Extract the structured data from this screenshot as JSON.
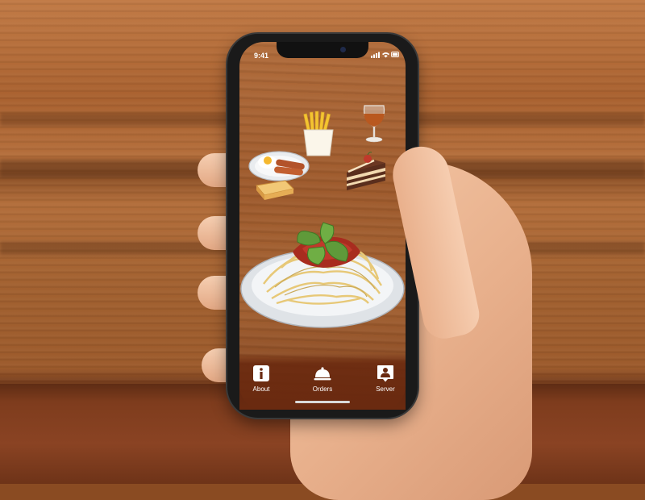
{
  "status_bar": {
    "time": "9:41"
  },
  "nav": {
    "items": [
      {
        "label": "About",
        "icon": "info-icon"
      },
      {
        "label": "Orders",
        "icon": "cloche-icon"
      },
      {
        "label": "Server",
        "icon": "server-person-icon"
      }
    ]
  },
  "menu_items": [
    {
      "icon": "fries-icon"
    },
    {
      "icon": "brandy-glass-icon"
    },
    {
      "icon": "breakfast-plate-icon"
    },
    {
      "icon": "toast-icon"
    },
    {
      "icon": "cake-slice-icon"
    },
    {
      "icon": "spaghetti-plate-icon"
    }
  ],
  "colors": {
    "nav_bg": "#6a2a10",
    "accent_red": "#c0392b",
    "label_white": "#ffffff"
  }
}
